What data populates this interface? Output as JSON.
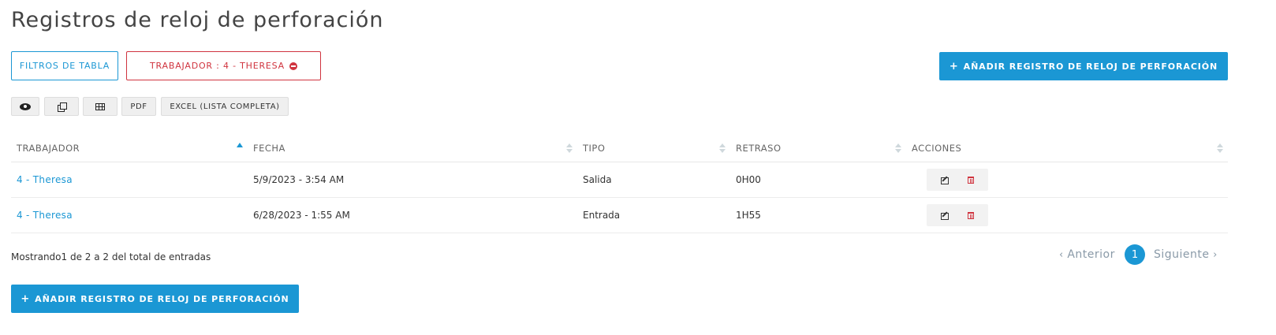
{
  "page": {
    "title": "Registros de reloj de perforación"
  },
  "toolbar": {
    "filters_label": "FILTROS DE TABLA",
    "active_filter_label": "TRABAJADOR : 4 - THERESA",
    "add_label": "AÑADIR REGISTRO DE RELOJ DE PERFORACIÓN"
  },
  "export": {
    "view_icon": "eye-icon",
    "copy_icon": "copy-icon",
    "csv_icon": "table-icon",
    "pdf_label": "PDF",
    "excel_label": "EXCEL (LISTA COMPLETA)"
  },
  "table": {
    "columns": [
      "TRABAJADOR",
      "FECHA",
      "TIPO",
      "RETRASO",
      "ACCIONES"
    ],
    "sorted_column": "TRABAJADOR",
    "rows": [
      {
        "worker": "4 - Theresa",
        "date": "5/9/2023 - 3:54 AM",
        "type": "Salida",
        "delay": "0H00"
      },
      {
        "worker": "4 - Theresa",
        "date": "6/28/2023 - 1:55 AM",
        "type": "Entrada",
        "delay": "1H55"
      }
    ]
  },
  "footer": {
    "showing": "Mostrando1 de 2 a 2 del total de entradas",
    "prev_label": "Anterior",
    "current_page": "1",
    "next_label": "Siguiente"
  },
  "colors": {
    "accent": "#1b97d4",
    "danger": "#d0343f"
  }
}
